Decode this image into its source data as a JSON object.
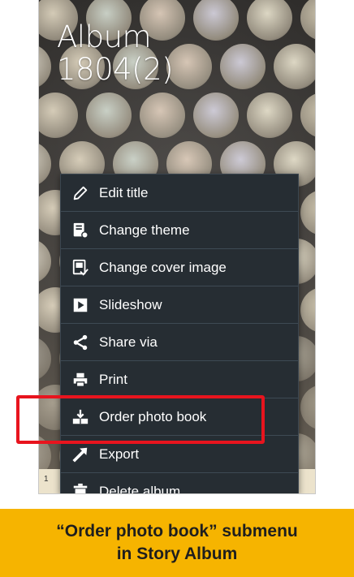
{
  "album": {
    "title_line1": "Album",
    "title_line2": "1804(2)"
  },
  "menu": {
    "items": [
      {
        "label": "Edit title",
        "icon": "pencil-icon"
      },
      {
        "label": "Change theme",
        "icon": "theme-icon"
      },
      {
        "label": "Change cover image",
        "icon": "cover-image-icon"
      },
      {
        "label": "Slideshow",
        "icon": "slideshow-icon"
      },
      {
        "label": "Share via",
        "icon": "share-icon"
      },
      {
        "label": "Print",
        "icon": "print-icon"
      },
      {
        "label": "Order photo book",
        "icon": "order-photo-book-icon"
      },
      {
        "label": "Export",
        "icon": "export-icon"
      },
      {
        "label": "Delete album",
        "icon": "trash-icon"
      }
    ],
    "highlighted_item": "Order photo book"
  },
  "colors": {
    "menu_bg": "#262d33",
    "highlight": "#e8141e",
    "caption_bg": "#f6b400"
  },
  "caption": {
    "line1": "“Order photo book” submenu",
    "line2": "in Story Album"
  },
  "bottom_strip": {
    "number": "1"
  }
}
